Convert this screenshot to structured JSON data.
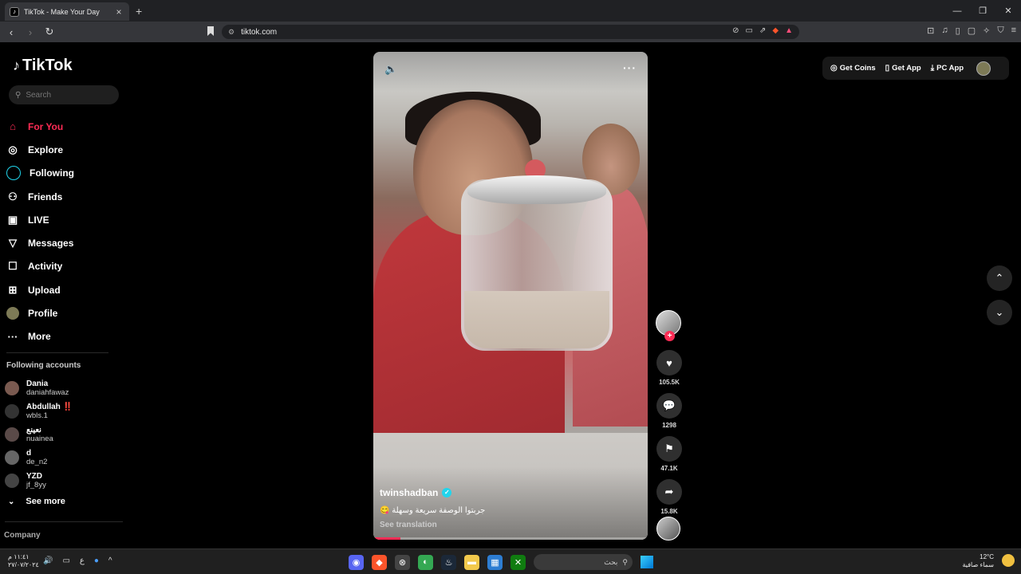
{
  "browser": {
    "tab_title": "TikTok - Make Your Day",
    "tab_close": "×",
    "new_tab": "+",
    "url": "tiktok.com",
    "window_controls": [
      "—",
      "❐",
      "✕"
    ]
  },
  "sidebar": {
    "logo_text": "TikTok",
    "search_placeholder": "Search",
    "nav": [
      {
        "label": "For You",
        "icon": "home-icon",
        "glyph": "⌂",
        "active": true
      },
      {
        "label": "Explore",
        "icon": "compass-icon",
        "glyph": "◎"
      },
      {
        "label": "Following",
        "icon": "following-ring-icon",
        "glyph": "○"
      },
      {
        "label": "Friends",
        "icon": "friends-icon",
        "glyph": "⚇"
      },
      {
        "label": "LIVE",
        "icon": "live-icon",
        "glyph": "▣"
      },
      {
        "label": "Messages",
        "icon": "send-icon",
        "glyph": "▽"
      },
      {
        "label": "Activity",
        "icon": "activity-icon",
        "glyph": "☐"
      },
      {
        "label": "Upload",
        "icon": "upload-icon",
        "glyph": "⊞"
      },
      {
        "label": "Profile",
        "icon": "profile-avatar-icon",
        "glyph": "●"
      },
      {
        "label": "More",
        "icon": "more-icon",
        "glyph": "···"
      }
    ],
    "following_title": "Following accounts",
    "following": [
      {
        "name": "Dania",
        "handle": "daniahfawaz"
      },
      {
        "name": "Abdullah ‼️",
        "handle": "wbls.1"
      },
      {
        "name": "نعينع",
        "handle": "nuainea"
      },
      {
        "name": "d",
        "handle": "de_n2"
      },
      {
        "name": "YZD",
        "handle": "jf_8yy"
      }
    ],
    "see_more": "See more",
    "company": "Company"
  },
  "video": {
    "author": "twinshadban",
    "caption": "جربتوا الوصفة سريعة وسهلة 😋",
    "see_translation": "See translation",
    "progress": 0.1
  },
  "actions": {
    "likes": "105.5K",
    "comments": "1298",
    "saves": "47.1K",
    "shares": "15.8K"
  },
  "topbar": {
    "get_coins": "Get Coins",
    "get_app": "Get App",
    "pc_app": "PC App"
  },
  "taskbar": {
    "time": "١١:٤١ م",
    "date": "٢٧/٠٧/٢٠٢٤",
    "lang": "ع",
    "search_label": "بحث",
    "temp": "12°C",
    "weather": "سماء صافية"
  },
  "colors": {
    "accent": "#fe2c55",
    "verified": "#20d5ec"
  }
}
